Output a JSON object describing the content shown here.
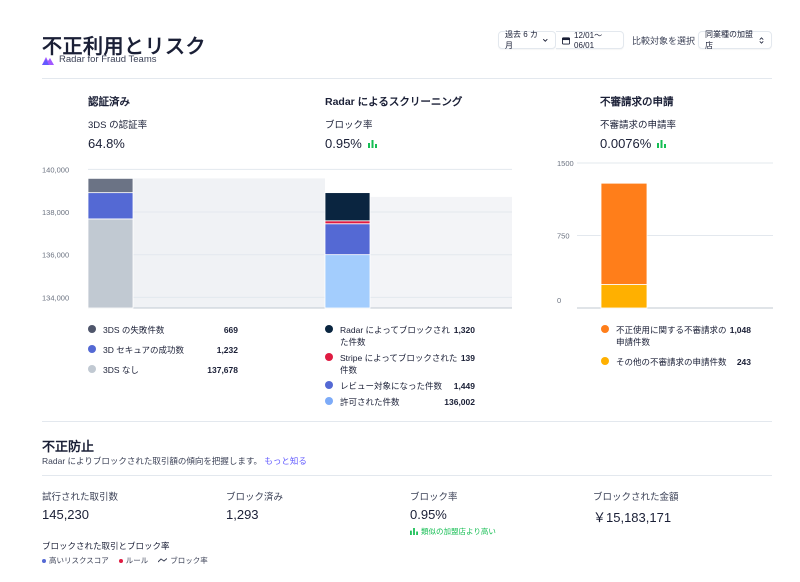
{
  "header": {
    "title": "不正利用とリスク",
    "subtitle": "Radar for Fraud Teams",
    "period": "過去 6 カ月",
    "date_range": "12/01～06/01",
    "compare_label": "比較対象を選択",
    "compare_value": "同業種の加盟店"
  },
  "columns": [
    {
      "title": "認証済み",
      "metric_label": "3DS の認証率",
      "metric_value": "64.8%",
      "legend": [
        {
          "label": "3DS の失敗件数",
          "value": "669",
          "color": "#4f566b"
        },
        {
          "label": "3D セキュアの成功数",
          "value": "1,232",
          "color": "#5469d4"
        },
        {
          "label": "3DS なし",
          "value": "137,678",
          "color": "#c1c9d2"
        }
      ]
    },
    {
      "title": "Radar によるスクリーニング",
      "metric_label": "ブロック率",
      "metric_value": "0.95%",
      "legend": [
        {
          "label": "Radar によってブロックされた件数",
          "value": "1,320",
          "color": "#0a2540"
        },
        {
          "label": "Stripe によってブロックされた件数",
          "value": "139",
          "color": "#df1b41"
        },
        {
          "label": "レビュー対象になった件数",
          "value": "1,449",
          "color": "#5469d4"
        },
        {
          "label": "許可された件数",
          "value": "136,002",
          "color": "#7dabf8"
        }
      ]
    },
    {
      "title": "不審請求の申請",
      "metric_label": "不審請求の申請率",
      "metric_value": "0.0076%",
      "legend": [
        {
          "label": "不正使用に関する不審請求の申請件数",
          "value": "1,048",
          "color": "#ff7e1a"
        },
        {
          "label": "その他の不審請求の申請件数",
          "value": "243",
          "color": "#ffb000"
        }
      ]
    }
  ],
  "chart_data": [
    {
      "type": "bar",
      "stacked": true,
      "y_ticks": [
        "140,000",
        "138,000",
        "136,000",
        "134,000"
      ],
      "ylim": [
        133500,
        140300
      ],
      "categories": [
        "認証済み",
        "Radar によるスクリーニング"
      ],
      "series": [
        {
          "name": "3DS なし",
          "category": 0,
          "value": 137678,
          "color": "#c1c9d2"
        },
        {
          "name": "3D セキュアの成功数",
          "category": 0,
          "value": 1232,
          "color": "#5469d4"
        },
        {
          "name": "3DS の失敗件数",
          "category": 0,
          "value": 669,
          "color": "#6b7385"
        },
        {
          "name": "許可された件数",
          "category": 1,
          "value": 136002,
          "color": "#a3cdfd"
        },
        {
          "name": "レビュー対象になった件数",
          "category": 1,
          "value": 1449,
          "color": "#5469d4"
        },
        {
          "name": "Stripe によってブロックされた件数",
          "category": 1,
          "value": 139,
          "color": "#df1b41"
        },
        {
          "name": "Radar によってブロックされた件数",
          "category": 1,
          "value": 1320,
          "color": "#0a2540"
        }
      ]
    },
    {
      "type": "bar",
      "stacked": true,
      "y_ticks": [
        "1500",
        "750",
        "0"
      ],
      "ylim": [
        0,
        1500
      ],
      "categories": [
        "不審請求の申請"
      ],
      "series": [
        {
          "name": "その他の不審請求の申請件数",
          "value": 243,
          "color": "#ffb000"
        },
        {
          "name": "不正使用に関する不審請求の申請件数",
          "value": 1048,
          "color": "#ff7e1a"
        }
      ]
    }
  ],
  "fraud": {
    "title": "不正防止",
    "desc": "Radar によりブロックされた取引額の傾向を把握します。",
    "link": "もっと知る",
    "stats": [
      {
        "label": "試行された取引数",
        "value": "145,230"
      },
      {
        "label": "ブロック済み",
        "value": "1,293"
      },
      {
        "label": "ブロック率",
        "value": "0.95%"
      },
      {
        "label": "ブロックされた金額",
        "value": "￥15,183,171"
      }
    ],
    "benchmark": "類似の加盟店より高い",
    "trend_title": "ブロックされた取引とブロック率",
    "trend_legend": [
      {
        "label": "高いリスクスコア",
        "color": "#5469d4"
      },
      {
        "label": "ルール",
        "color": "#df1b41"
      },
      {
        "label": "ブロック率",
        "color": "#3c4257"
      }
    ]
  }
}
